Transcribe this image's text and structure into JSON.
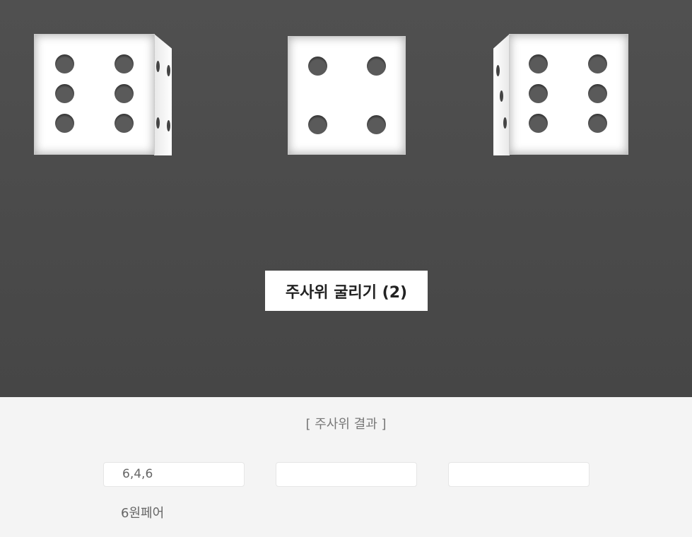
{
  "dice": [
    {
      "value": 6
    },
    {
      "value": 4
    },
    {
      "value": 6
    }
  ],
  "roll_button": "주사위 굴리기 (2)",
  "results": {
    "title": "[ 주사위 결과 ]",
    "fields": [
      "6,4,6",
      "",
      ""
    ],
    "summary": "6원페어"
  }
}
